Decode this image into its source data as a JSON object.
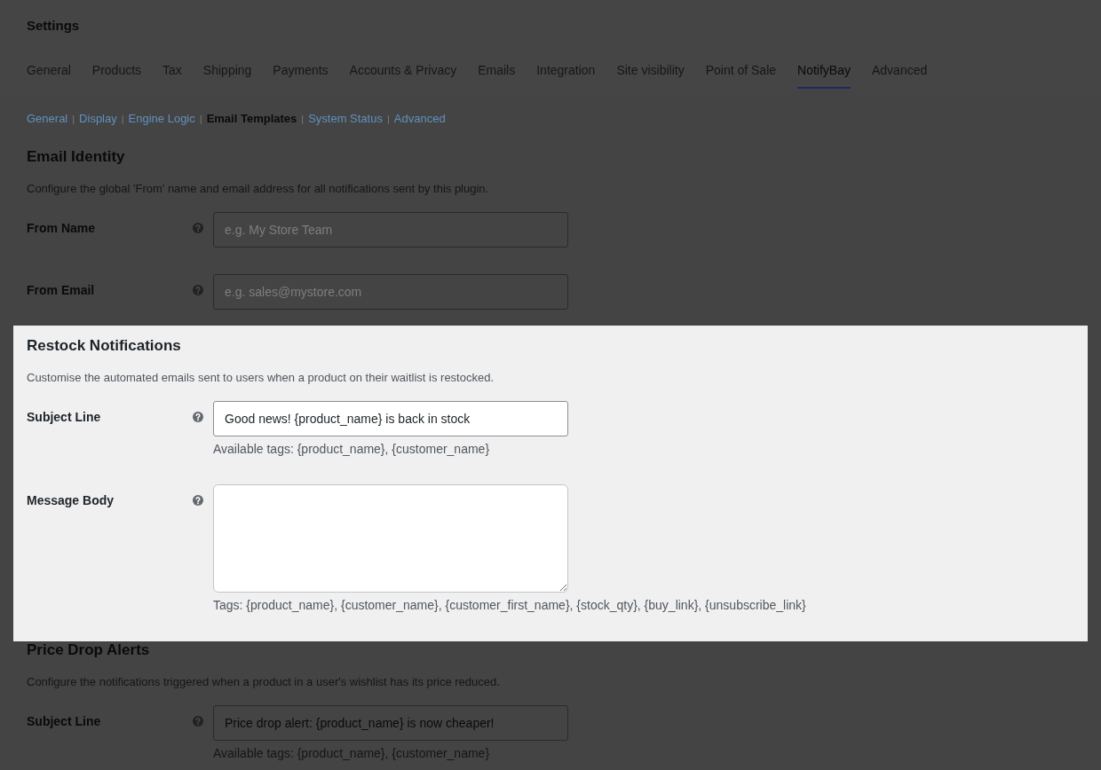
{
  "page": {
    "title": "Settings"
  },
  "tabs": [
    {
      "label": "General",
      "selected": false
    },
    {
      "label": "Products",
      "selected": false
    },
    {
      "label": "Tax",
      "selected": false
    },
    {
      "label": "Shipping",
      "selected": false
    },
    {
      "label": "Payments",
      "selected": false
    },
    {
      "label": "Accounts & Privacy",
      "selected": false
    },
    {
      "label": "Emails",
      "selected": false
    },
    {
      "label": "Integration",
      "selected": false
    },
    {
      "label": "Site visibility",
      "selected": false
    },
    {
      "label": "Point of Sale",
      "selected": false
    },
    {
      "label": "NotifyBay",
      "selected": true
    },
    {
      "label": "Advanced",
      "selected": false
    }
  ],
  "subnav": {
    "separator": "|",
    "items": [
      {
        "label": "General",
        "selected": false
      },
      {
        "label": "Display",
        "selected": false
      },
      {
        "label": "Engine Logic",
        "selected": false
      },
      {
        "label": "Email Templates",
        "selected": true
      },
      {
        "label": "System Status",
        "selected": false
      },
      {
        "label": "Advanced",
        "selected": false
      }
    ]
  },
  "sections": [
    {
      "title": "Email Identity",
      "description": "Configure the global 'From' name and email address for all notifications sent by this plugin.",
      "highlighted": false,
      "fields": [
        {
          "kind": "input",
          "label": "From Name",
          "placeholder": "e.g. My Store Team"
        },
        {
          "kind": "input",
          "label": "From Email",
          "placeholder": "e.g. sales@mystore.com"
        }
      ]
    },
    {
      "title": "Restock Notifications",
      "description": "Customise the automated emails sent to users when a product on their waitlist is restocked.",
      "highlighted": true,
      "fields": [
        {
          "kind": "input",
          "label": "Subject Line",
          "value": "Good news! {product_name} is back in stock",
          "help": "Available tags: {product_name}, {customer_name}"
        },
        {
          "kind": "textarea",
          "label": "Message Body",
          "help": "Tags: {product_name}, {customer_name}, {customer_first_name}, {stock_qty}, {buy_link}, {unsubscribe_link}"
        }
      ]
    },
    {
      "title": "Price Drop Alerts",
      "description": "Configure the notifications triggered when a product in a user's wishlist has its price reduced.",
      "highlighted": false,
      "fields": [
        {
          "kind": "input",
          "label": "Subject Line",
          "value": "Price drop alert: {product_name} is now cheaper!",
          "help": "Available tags: {product_name}, {customer_name}"
        }
      ]
    }
  ]
}
